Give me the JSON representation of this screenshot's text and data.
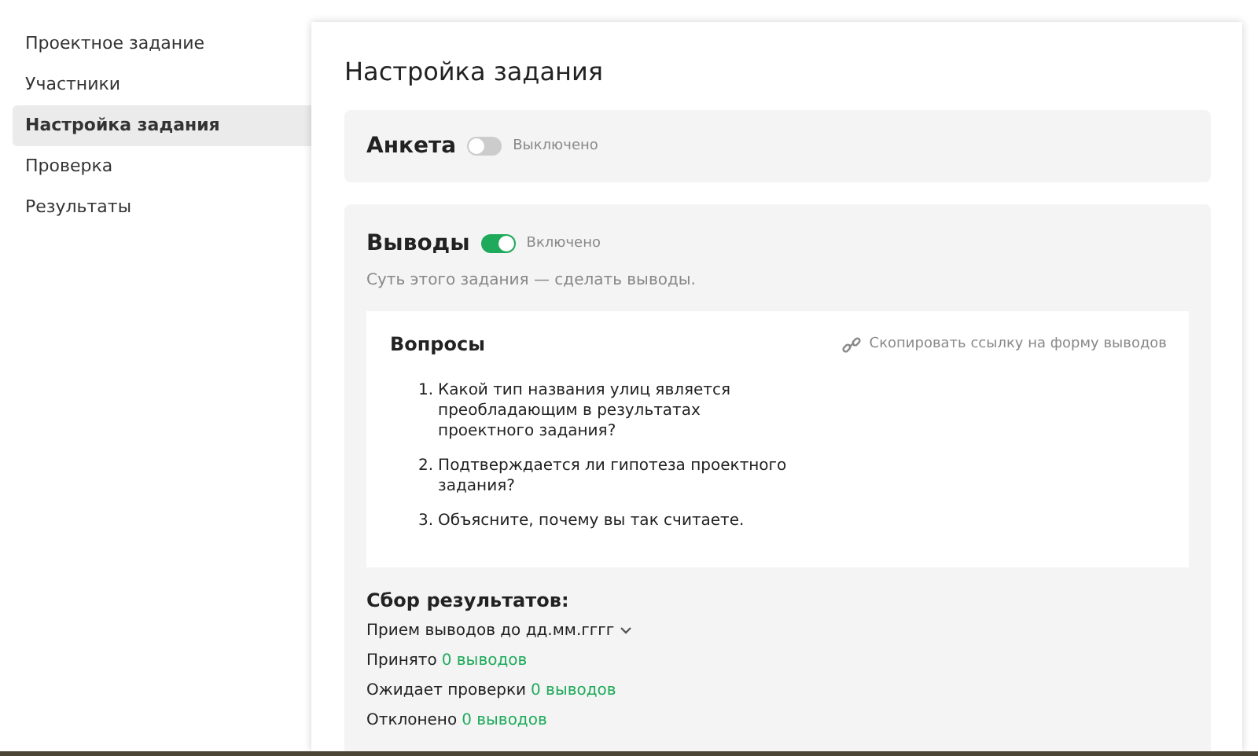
{
  "sidebar": {
    "items": [
      {
        "label": "Проектное задание",
        "selected": false
      },
      {
        "label": "Участники",
        "selected": false
      },
      {
        "label": "Настройка задания",
        "selected": true
      },
      {
        "label": "Проверка",
        "selected": false
      },
      {
        "label": "Результаты",
        "selected": false
      }
    ]
  },
  "page_title": "Настройка задания",
  "sections": [
    {
      "title": "Анкета",
      "enabled": false,
      "state_label": "Выключено"
    },
    {
      "title": "Выводы",
      "enabled": true,
      "state_label": "Включено",
      "description": "Суть этого задания — сделать выводы.",
      "questions": {
        "title": "Вопросы",
        "copy_link": "Скопировать ссылку на форму выводов",
        "items": [
          {
            "number": "1.",
            "text": "Какой тип названия улиц является преобладающим в результатах проектного задания?"
          },
          {
            "number": "2.",
            "text": "Подтверждается ли гипотеза проектного задания?"
          },
          {
            "number": "3.",
            "text": "Объясните, почему вы так считаете."
          }
        ]
      },
      "results": {
        "title": "Сбор результатов:",
        "deadline": "Прием выводов до дд.мм.гггг",
        "stats": [
          {
            "label": "Принято",
            "value": "0 выводов"
          },
          {
            "label": "Ожидает проверки",
            "value": "0 выводов"
          },
          {
            "label": "Отклонено",
            "value": "0 выводов"
          }
        ]
      }
    }
  ]
}
